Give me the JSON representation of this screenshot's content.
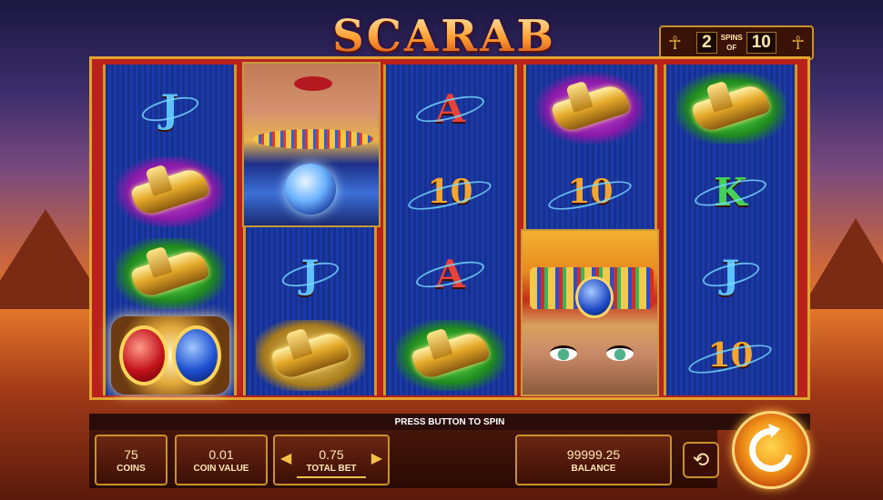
{
  "game": {
    "title": "SCARAB",
    "spins": {
      "label": "SPINS",
      "current": "2",
      "of_label": "OF",
      "total": "10"
    }
  },
  "reels": [
    {
      "symbols": [
        "J",
        "purple-scarab",
        "green-scarab",
        "wild-scarab"
      ]
    },
    {
      "symbols": [
        "queen-portrait",
        "J",
        "gold-scarab"
      ]
    },
    {
      "symbols": [
        "A",
        "10",
        "A",
        "green-scarab"
      ]
    },
    {
      "symbols": [
        "purple-scarab",
        "10",
        "pharaoh-portrait"
      ]
    },
    {
      "symbols": [
        "green-scarab",
        "K",
        "J",
        "10"
      ]
    }
  ],
  "letters": {
    "r1c1": "J",
    "r2c2": "J",
    "r3c1": "A",
    "r3c2": "10",
    "r3c3": "A",
    "r4c2": "10",
    "r5c2": "K",
    "r5c3": "J",
    "r5c4": "10"
  },
  "message": "PRESS BUTTON TO SPIN",
  "controls": {
    "coins": {
      "value": "75",
      "label": "COINS"
    },
    "coin_value": {
      "value": "0.01",
      "label": "COIN VALUE"
    },
    "total_bet": {
      "value": "0.75",
      "label": "TOTAL BET"
    },
    "balance": {
      "value": "99999.25",
      "label": "BALANCE"
    }
  },
  "colors": {
    "frame_red": "#b9211b",
    "frame_gold": "#e2a330",
    "reel_blue": "#1b3aa8",
    "spin_orange": "#f39a1b"
  }
}
